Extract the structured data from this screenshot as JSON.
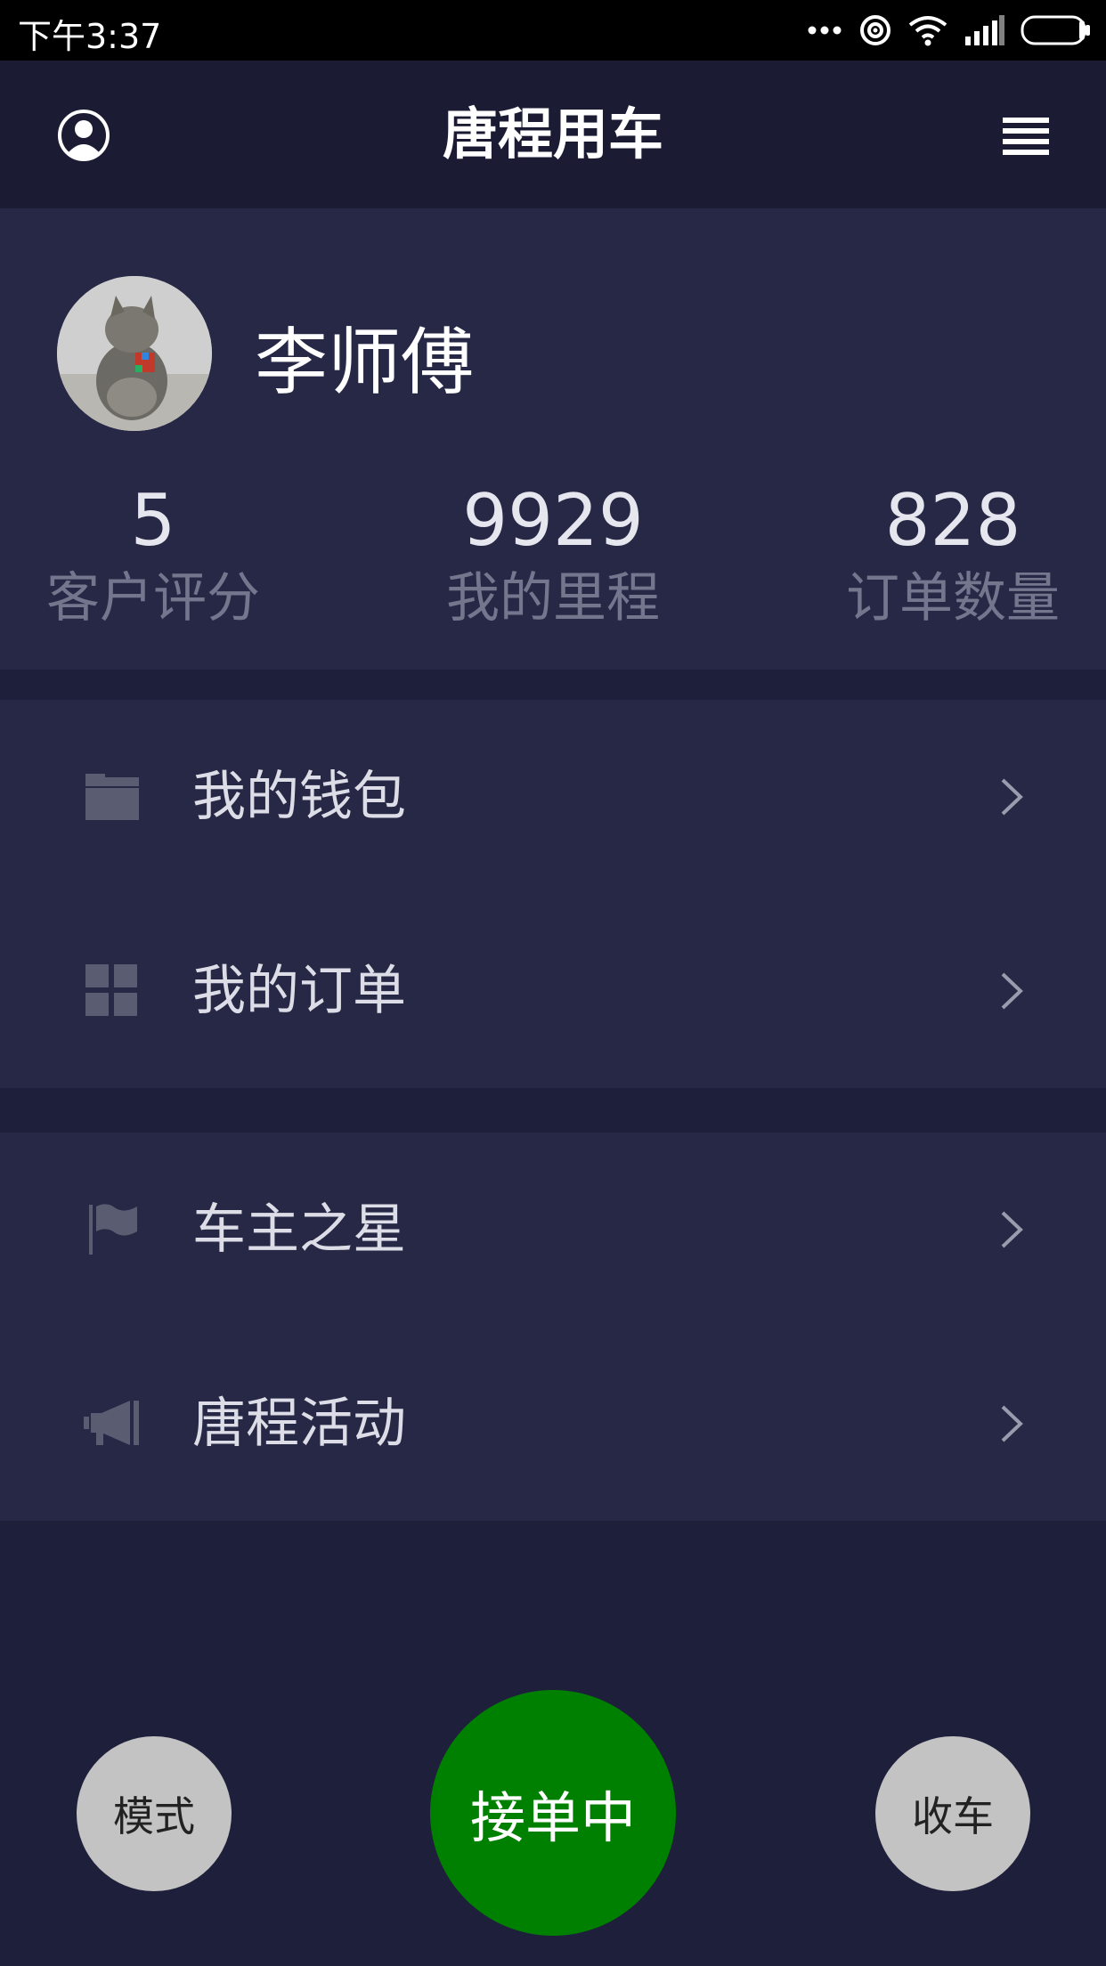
{
  "status_bar": {
    "time": "下午3:37",
    "icons": [
      "more-dots-icon",
      "hotspot-icon",
      "wifi-icon",
      "signal-icon",
      "battery-icon"
    ]
  },
  "topbar": {
    "title": "唐程用车",
    "left_icon": "profile-icon",
    "right_icon": "menu-icon"
  },
  "profile": {
    "name": "李师傅",
    "stats": [
      {
        "value": "5",
        "label": "客户评分"
      },
      {
        "value": "9929",
        "label": "我的里程"
      },
      {
        "value": "828",
        "label": "订单数量"
      }
    ]
  },
  "menu_group_1": [
    {
      "label": "我的钱包",
      "icon": "wallet-icon"
    },
    {
      "label": "我的订单",
      "icon": "grid-icon"
    }
  ],
  "menu_group_2": [
    {
      "label": "车主之星",
      "icon": "flag-icon"
    },
    {
      "label": "唐程活动",
      "icon": "megaphone-icon"
    }
  ],
  "bottom_buttons": {
    "mode": "模式",
    "accepting": "接单中",
    "close": "收车"
  },
  "colors": {
    "background": "#1e1f3b",
    "card": "#262846",
    "accept_button": "#008000",
    "side_button": "#c3c3c3"
  }
}
